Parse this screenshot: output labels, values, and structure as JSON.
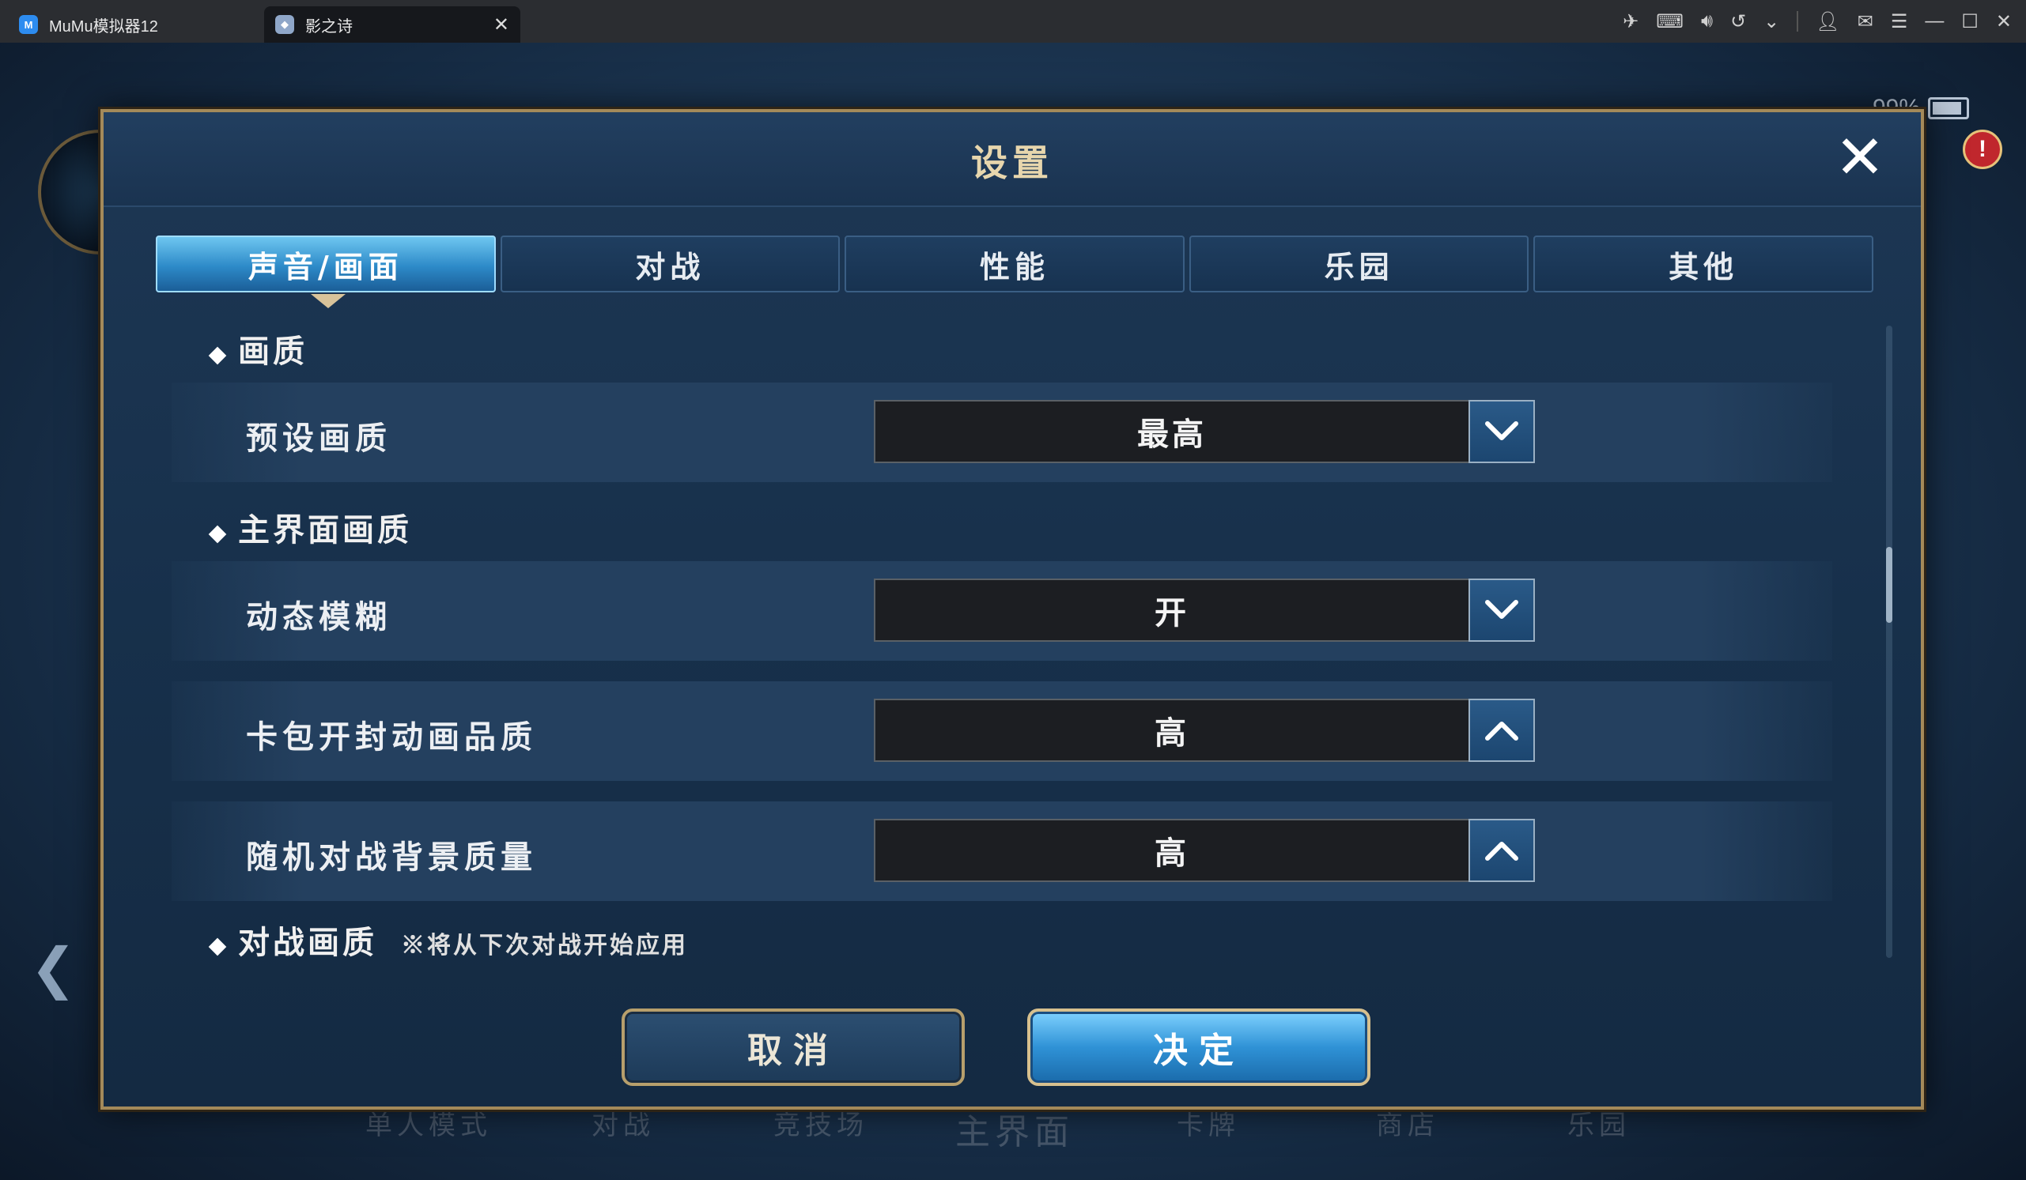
{
  "emulator": {
    "app_tab": "MuMu模拟器12",
    "app_logo": "M",
    "game_tab": "影之诗",
    "close_glyph": "✕",
    "toolbar_icons": [
      "operation-icon",
      "keyboard-icon",
      "volume-icon",
      "rotate-back-icon",
      "chevron-down-icon",
      "user-icon",
      "mail-icon",
      "menu-icon",
      "minimize-icon",
      "maximize-icon",
      "window-close-icon"
    ]
  },
  "game_hud": {
    "battery": "99%",
    "alert": "!",
    "left_arrow": "❮"
  },
  "dialog": {
    "title": "设置",
    "close": "✕",
    "tabs": [
      "声音/画面",
      "对战",
      "性能",
      "乐园",
      "其他"
    ],
    "active_tab": 0,
    "sections": {
      "s1": "画质",
      "s2": "主界面画质",
      "s3": "对战画质",
      "s3_note": "※将从下次对战开始应用"
    },
    "rows": [
      {
        "label": "预设画质",
        "value": "最高",
        "arrow": "down"
      },
      {
        "label": "动态模糊",
        "value": "开",
        "arrow": "down"
      },
      {
        "label": "卡包开封动画品质",
        "value": "高",
        "arrow": "up"
      },
      {
        "label": "随机对战背景质量",
        "value": "高",
        "arrow": "up"
      }
    ],
    "cancel": "取消",
    "confirm": "决定"
  },
  "bottom_nav": [
    "单人模式",
    "对战",
    "竞技场",
    "主界面",
    "卡牌",
    "商店",
    "乐园"
  ],
  "colors": {
    "accent": "#2d8ac8",
    "gold_border": "#a48a5a",
    "dialog_bg": "#17304b"
  }
}
